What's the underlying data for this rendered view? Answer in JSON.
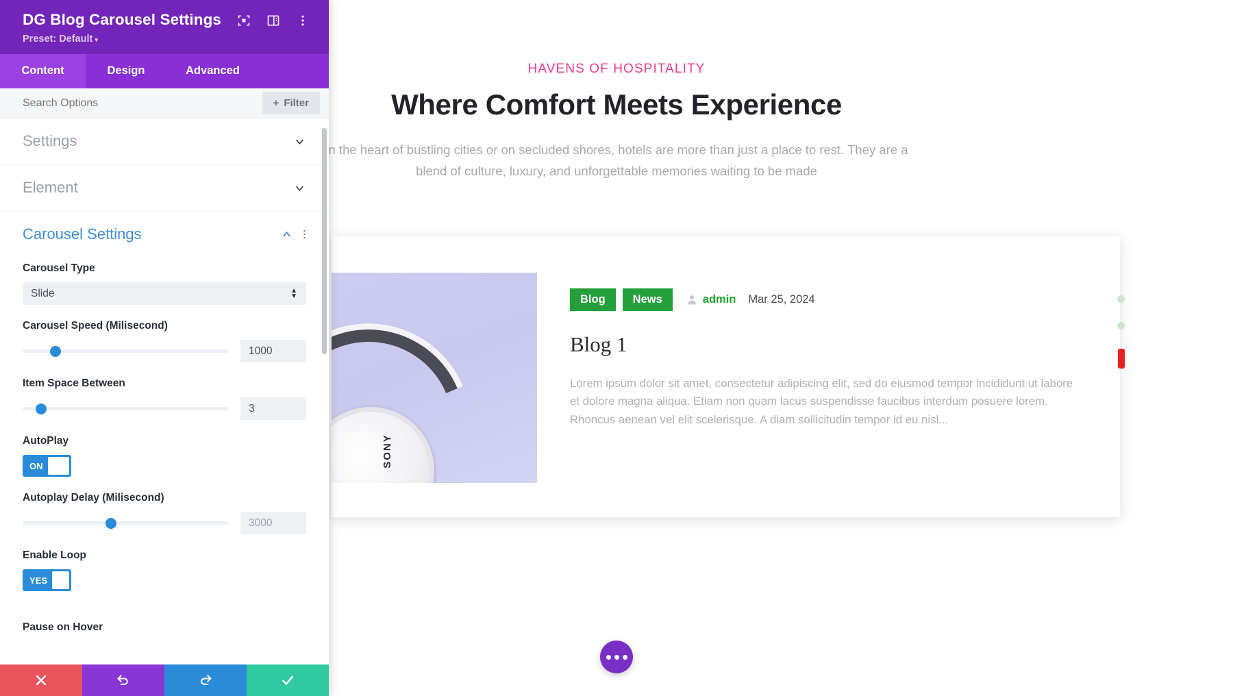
{
  "panel": {
    "title": "DG Blog Carousel Settings",
    "preset_label": "Preset: Default",
    "header_icons": [
      "focus-target-icon",
      "layout-panel-icon",
      "vertical-dots-icon"
    ],
    "tabs": [
      {
        "label": "Content",
        "active": true
      },
      {
        "label": "Design",
        "active": false
      },
      {
        "label": "Advanced",
        "active": false
      }
    ],
    "search": {
      "placeholder": "Search Options",
      "value": ""
    },
    "filter_button": {
      "label": "Filter",
      "icon": "plus-icon"
    },
    "accordions": [
      {
        "label": "Settings",
        "open": false,
        "icon": "chevron-down-icon"
      },
      {
        "label": "Element",
        "open": false,
        "icon": "chevron-down-icon"
      },
      {
        "label": "Carousel Settings",
        "open": true,
        "icon": "chevron-up-icon"
      }
    ],
    "carousel_settings": {
      "carousel_type": {
        "label": "Carousel Type",
        "value": "Slide"
      },
      "carousel_speed": {
        "label": "Carousel Speed (Milisecond)",
        "value": "1000",
        "knob_percent": 16
      },
      "item_space_between": {
        "label": "Item Space Between",
        "value": "3",
        "knob_percent": 9
      },
      "autoplay": {
        "label": "AutoPlay",
        "value": "ON"
      },
      "autoplay_delay": {
        "label": "Autoplay Delay (Milisecond)",
        "value": "3000",
        "knob_percent": 43
      },
      "enable_loop": {
        "label": "Enable Loop",
        "value": "YES"
      },
      "pause_on_hover": {
        "label": "Pause on Hover"
      }
    },
    "actions": [
      {
        "name": "cancel",
        "icon": "close-x-icon",
        "color": "#e9545e"
      },
      {
        "name": "undo",
        "icon": "undo-arrow-icon",
        "color": "#8a35d6"
      },
      {
        "name": "redo",
        "icon": "redo-arrow-icon",
        "color": "#2a8bd8"
      },
      {
        "name": "save",
        "icon": "check-icon",
        "color": "#31c9a0"
      }
    ]
  },
  "preview": {
    "hero": {
      "eyebrow": "HAVENS OF HOSPITALITY",
      "title": "Where Comfort Meets Experience",
      "subtitle": "In the heart of bustling cities or on secluded shores, hotels are more than just a place to rest. They are a blend of culture, luxury, and unforgettable memories waiting to be made"
    },
    "blog_card": {
      "image_alt": "sony-headphones-image",
      "categories": [
        "Blog",
        "News"
      ],
      "author": "admin",
      "author_icon": "user-avatar-icon",
      "date": "Mar 25, 2024",
      "title": "Blog 1",
      "excerpt": "Lorem ipsum dolor sit amet, consectetur adipiscing elit, sed do eiusmod tempor incididunt ut labore et dolore magna aliqua. Etiam non quam lacus suspendisse faucibus interdum posuere lorem. Rhoncus aenean vel elit scelerisque. A diam sollicitudin tempor id eu nisl...",
      "brand_on_image": "SONY"
    },
    "pagination": {
      "dots": 2,
      "active_index": 2,
      "dot_color": "#c9e8cd",
      "active_color": "#e8221f"
    },
    "fab": {
      "icon": "three-dots-icon",
      "color": "#7a2fc4"
    },
    "colors": {
      "eyebrow": "#ef3b8e",
      "chip": "#23a03a",
      "author": "#1fa32f"
    }
  }
}
